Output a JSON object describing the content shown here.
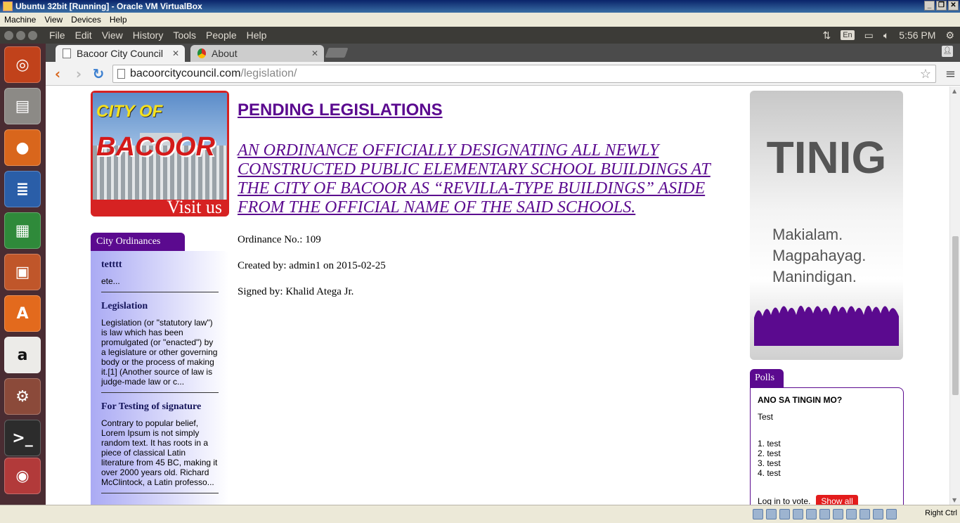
{
  "vbox": {
    "title": "Ubuntu 32bit [Running] - Oracle VM VirtualBox",
    "menu": [
      "Machine",
      "View",
      "Devices",
      "Help"
    ],
    "host_key": "Right Ctrl"
  },
  "ubuntu_panel": {
    "app_menus": [
      "File",
      "Edit",
      "View",
      "History",
      "Tools",
      "People",
      "Help"
    ],
    "lang": "En",
    "time": "5:56 PM"
  },
  "launcher": {
    "items": [
      "ubuntu-dash",
      "files",
      "firefox",
      "libreoffice-writer",
      "libreoffice-calc",
      "libreoffice-impress",
      "ubuntu-software-center",
      "amazon",
      "system-settings",
      "terminal",
      "chrome"
    ]
  },
  "browser": {
    "tabs": [
      {
        "title": "Bacoor City Council",
        "active": true
      },
      {
        "title": "About",
        "active": false
      }
    ],
    "url_host": "bacoorcitycouncil.com",
    "url_path": "/legislation/"
  },
  "page": {
    "logo": {
      "top_text": "CITY OF",
      "name": "BACOOR",
      "visit": "Visit us"
    },
    "sidebar": {
      "tab_label": "City Ordinances",
      "items": [
        {
          "title": "tetttt",
          "excerpt": "ete..."
        },
        {
          "title": "Legislation",
          "excerpt": "Legislation (or \"statutory law\") is law which has been promulgated (or \"enacted\") by a legislature or other governing body or the process of making it.[1] (Another source of law is judge-made law or c..."
        },
        {
          "title": "For Testing of signature",
          "excerpt": "Contrary to popular belief, Lorem Ipsum is not simply random text. It has roots in a piece of classical Latin literature from 45 BC, making it over 2000 years old. Richard McClintock, a Latin professo..."
        }
      ]
    },
    "main": {
      "heading": "PENDING LEGISLATIONS",
      "ordinance_title": "AN ORDINANCE OFFICIALLY DESIGNATING ALL NEWLY CONSTRUCTED PUBLIC ELEMENTARY SCHOOL BUILDINGS AT THE CITY OF BACOOR AS “REVILLA-TYPE BUILDINGS” ASIDE FROM THE OFFICIAL NAME OF THE SAID SCHOOLS.",
      "ordinance_no": "Ordinance No.: 109",
      "created_by": "Created by: admin1 on 2015-02-25",
      "signed_by": "Signed by: Khalid Atega Jr."
    },
    "tinig": {
      "big": "TINIG",
      "line1": "Makialam.",
      "line2": "Magpahayag.",
      "line3": "Manindigan."
    },
    "polls": {
      "tab_label": "Polls",
      "question": "ANO SA TINGIN MO?",
      "description": "Test",
      "options": [
        "1. test",
        "2. test",
        "3. test",
        "4. test"
      ],
      "login_text": "Log in to vote.",
      "show_all": "Show all"
    }
  },
  "colors": {
    "brand_purple": "#5b0a8f",
    "launcher_bg": "#4a2c32",
    "panel_bg": "#3c3b37",
    "show_all_red": "#e31c1c"
  }
}
